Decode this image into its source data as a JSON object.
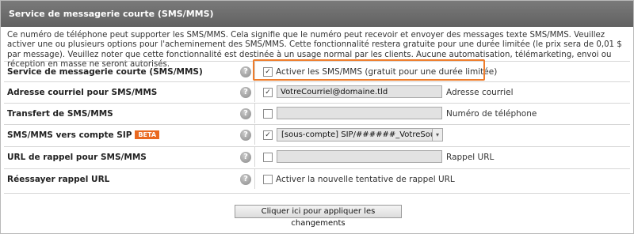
{
  "panel": {
    "title": "Service de messagerie courte (SMS/MMS)",
    "description": "Ce numéro de téléphone peut supporter les SMS/MMS. Cela signifie que le numéro peut recevoir et envoyer des messages texte SMS/MMS. Veuillez activer une ou plusieurs options pour l'acheminement des SMS/MMS. Cette fonctionnalité restera gratuite pour une durée limitée (le prix sera de 0,01 $ par message). Veuillez noter que cette fonctionnalité est destinée à un usage normal par les clients. Aucune automatisation, télémarketing, envoi ou réception en masse ne seront autorisés."
  },
  "rows": {
    "sms_service": {
      "label": "Service de messagerie courte (SMS/MMS)",
      "checked": true,
      "checkbox_text": "Activer les SMS/MMS (gratuit pour une durée limitée)"
    },
    "email": {
      "label": "Adresse courriel pour SMS/MMS",
      "checked": true,
      "value": "VotreCourriel@domaine.tld",
      "after_text": "Adresse courriel"
    },
    "forward": {
      "label": "Transfert de SMS/MMS",
      "checked": false,
      "value": "",
      "after_text": "Numéro de téléphone"
    },
    "sip": {
      "label": "SMS/MMS vers compte SIP",
      "badge": "BETA",
      "checked": true,
      "selected": "[sous-compte] SIP/######_VotreSousCompte"
    },
    "callback": {
      "label": "URL de rappel pour SMS/MMS",
      "checked": false,
      "value": "",
      "after_text": "Rappel URL"
    },
    "retry": {
      "label": "Réessayer rappel URL",
      "checked": false,
      "checkbox_text": "Activer la nouvelle tentative de rappel URL"
    }
  },
  "help_symbol": "?",
  "check_mark": "✓",
  "dropdown_arrow": "▾",
  "apply_button": "Cliquer ici pour appliquer les changements",
  "colors": {
    "header_bg": "#6e6e6e",
    "highlight": "#ef7d2c",
    "beta_badge": "#e9681f"
  }
}
